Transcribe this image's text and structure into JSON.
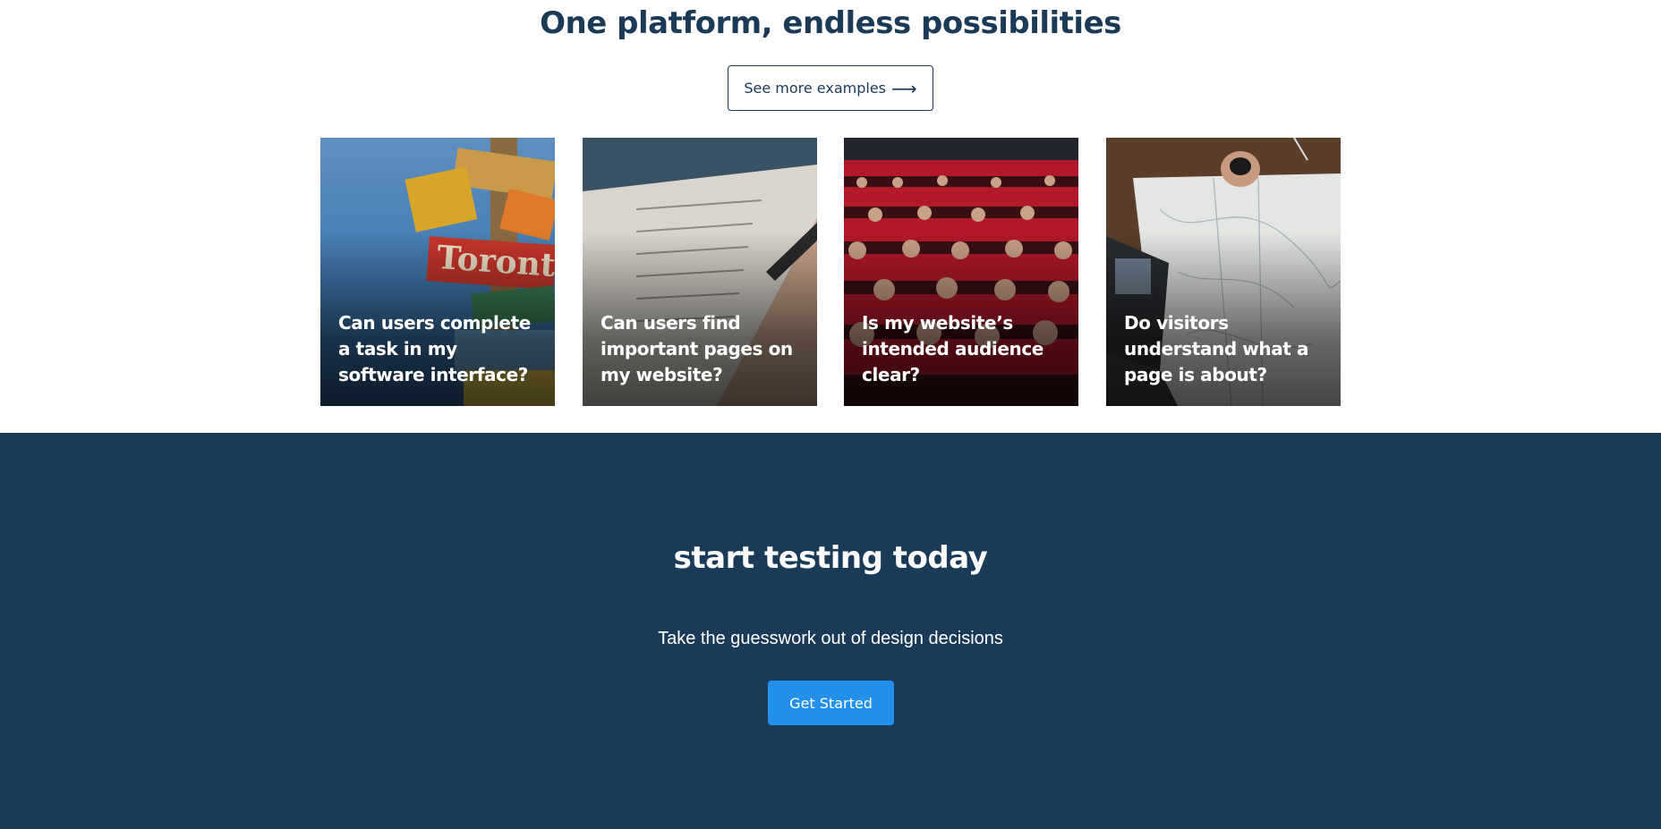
{
  "examples": {
    "title": "One platform, endless possibilities",
    "button_label": "See more examples",
    "button_icon": "arrow-right-icon",
    "cards": [
      {
        "caption": "Can users complete a task in my software interface?",
        "image": "signpost-photo"
      },
      {
        "caption": "Can users find important pages on my website?",
        "image": "checklist-writing-photo"
      },
      {
        "caption": "Is my website’s intended audience clear?",
        "image": "theater-audience-photo"
      },
      {
        "caption": "Do visitors understand what a page is about?",
        "image": "map-laptop-desk-photo"
      }
    ]
  },
  "cta": {
    "title": "start testing today",
    "subtitle": "Take the guesswork out of design decisions",
    "button_label": "Get Started"
  },
  "colors": {
    "navy": "#1b3a57",
    "accent_blue": "#2390ec",
    "white": "#ffffff"
  }
}
